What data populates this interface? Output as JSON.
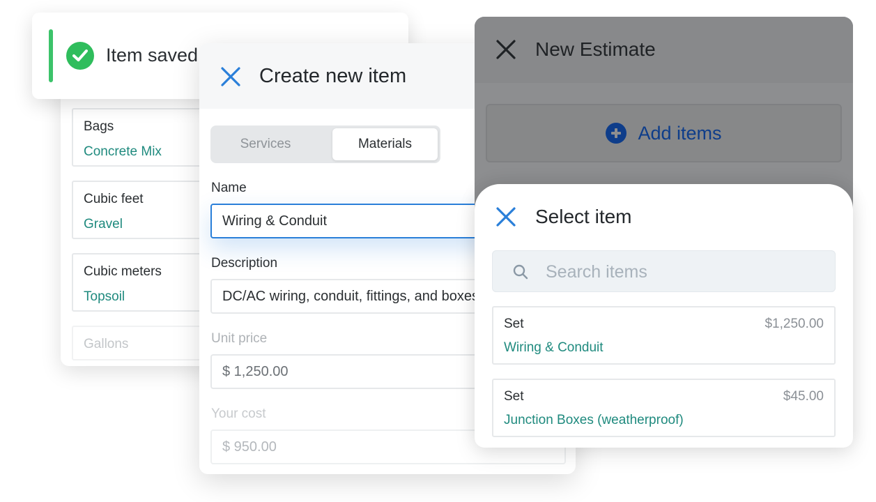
{
  "colors": {
    "accent_blue": "#2a7fd9",
    "teal_text": "#1f8a7e",
    "success_green": "#2fbd5c",
    "overlay_gray": "#8d8e90",
    "dark_blue": "#0e3d8a"
  },
  "toast": {
    "icon": "check-circle-icon",
    "text": "Item saved"
  },
  "units_list": {
    "items": [
      {
        "label": "Bags",
        "name": "Concrete Mix"
      },
      {
        "label": "Cubic feet",
        "name": "Gravel"
      },
      {
        "label": "Cubic meters",
        "name": "Topsoil"
      },
      {
        "label": "Gallons",
        "name": ""
      }
    ]
  },
  "create_item": {
    "close_icon": "close-icon",
    "title": "Create new item",
    "tabs": [
      {
        "label": "Services",
        "selected": false
      },
      {
        "label": "Materials",
        "selected": true
      }
    ],
    "fields": {
      "name": {
        "label": "Name",
        "value": "Wiring & Conduit"
      },
      "description": {
        "label": "Description",
        "value": "DC/AC wiring, conduit, fittings, and boxes"
      },
      "unit_price": {
        "label": "Unit price",
        "value": "$ 1,250.00"
      },
      "your_cost": {
        "label": "Your cost",
        "value": "$ 950.00"
      }
    }
  },
  "estimate": {
    "close_icon": "close-icon",
    "title": "New Estimate",
    "add_items_icon": "plus-circle-icon",
    "add_items_label": "Add items"
  },
  "select_item": {
    "close_icon": "close-icon",
    "title": "Select item",
    "search_icon": "search-icon",
    "search_placeholder": "Search items",
    "search_value": "",
    "items": [
      {
        "unit": "Set",
        "price": "$1,250.00",
        "name": "Wiring & Conduit"
      },
      {
        "unit": "Set",
        "price": "$45.00",
        "name": "Junction Boxes (weatherproof)"
      }
    ]
  }
}
